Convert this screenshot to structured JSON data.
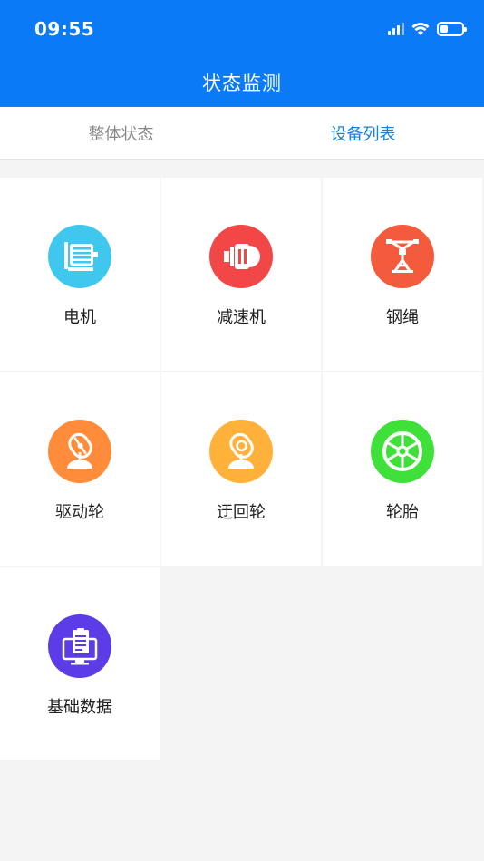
{
  "status_bar": {
    "time": "09:55",
    "battery_level": 0.35
  },
  "header": {
    "title": "状态监测"
  },
  "tabs": [
    {
      "label": "整体状态",
      "active": false
    },
    {
      "label": "设备列表",
      "active": true
    }
  ],
  "colors": {
    "header_bg": "#0a7af7",
    "active_tab": "#1a7fd9",
    "motor": "#3fc7ee",
    "reducer": "#f24747",
    "wire_rope": "#f45a3c",
    "drive_wheel": "#ff8c3a",
    "return_wheel": "#ffb13a",
    "tire": "#3fe03a",
    "basic_data": "#5b3ce6"
  },
  "devices": [
    {
      "label": "电机",
      "icon": "motor-icon"
    },
    {
      "label": "减速机",
      "icon": "reducer-icon"
    },
    {
      "label": "钢绳",
      "icon": "wire-rope-icon"
    },
    {
      "label": "驱动轮",
      "icon": "drive-wheel-icon"
    },
    {
      "label": "迂回轮",
      "icon": "return-wheel-icon"
    },
    {
      "label": "轮胎",
      "icon": "tire-icon"
    },
    {
      "label": "基础数据",
      "icon": "basic-data-icon"
    }
  ]
}
